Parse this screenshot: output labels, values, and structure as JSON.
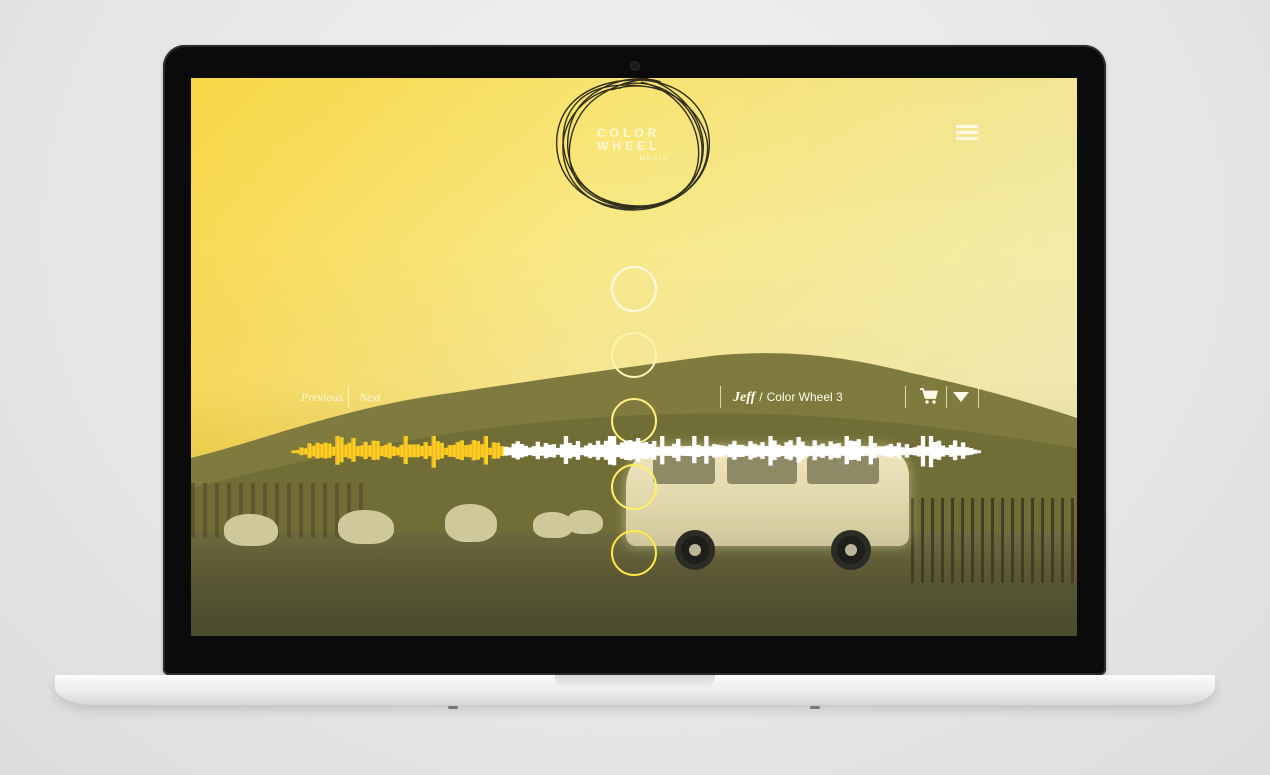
{
  "brand": {
    "line1": "COLOR",
    "line2": "WHEEL",
    "line3": "MUSIC"
  },
  "player": {
    "previous_label": "Previous",
    "next_label": "Next",
    "artist": "Jeff",
    "separator": "/",
    "title": "Color Wheel 3",
    "progress": 0.31
  },
  "icons": {
    "menu": "hamburger-menu-icon",
    "cart": "shopping-cart-icon",
    "dropdown": "triangle-down-icon"
  },
  "colors": {
    "played_start": "#f0a040",
    "played_end": "#fff200",
    "unplayed": "#ffffff",
    "ui_white": "#fffbe6"
  }
}
